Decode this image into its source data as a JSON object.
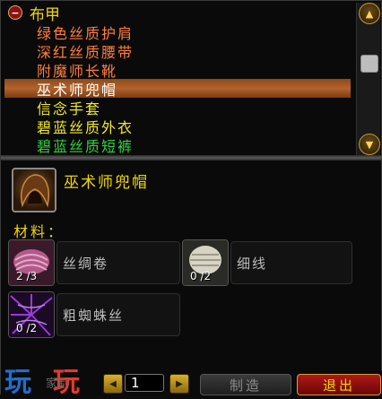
{
  "category": {
    "label": "布甲",
    "toggle": "−"
  },
  "recipes": [
    {
      "label": "绿色丝质护肩",
      "color": "orange"
    },
    {
      "label": "深红丝质腰带",
      "color": "orange"
    },
    {
      "label": "附魔师长靴",
      "color": "orange"
    },
    {
      "label": "巫术师兜帽",
      "color": "selected"
    },
    {
      "label": "信念手套",
      "color": "yellow"
    },
    {
      "label": "碧蓝丝质外衣",
      "color": "yellow"
    },
    {
      "label": "碧蓝丝质短裤",
      "color": "green"
    }
  ],
  "selected_item": {
    "name": "巫术师兜帽"
  },
  "materials_label": "材料：",
  "reagents": [
    {
      "name": "丝绸卷",
      "count": "2 /3"
    },
    {
      "name": "细线",
      "count": "0 /2"
    },
    {
      "name": "粗蜘蛛丝",
      "count": "0 /2"
    }
  ],
  "bottom": {
    "logo_left": "玩",
    "logo_mid": "家制",
    "logo_right": "玩",
    "quantity": "1",
    "create_label": "制造",
    "exit_label": "退出"
  },
  "icons": {
    "scroll_up": "scroll-up-arrow-icon",
    "scroll_down": "scroll-down-arrow-icon",
    "decrement": "left-arrow-icon",
    "increment": "right-arrow-icon"
  }
}
